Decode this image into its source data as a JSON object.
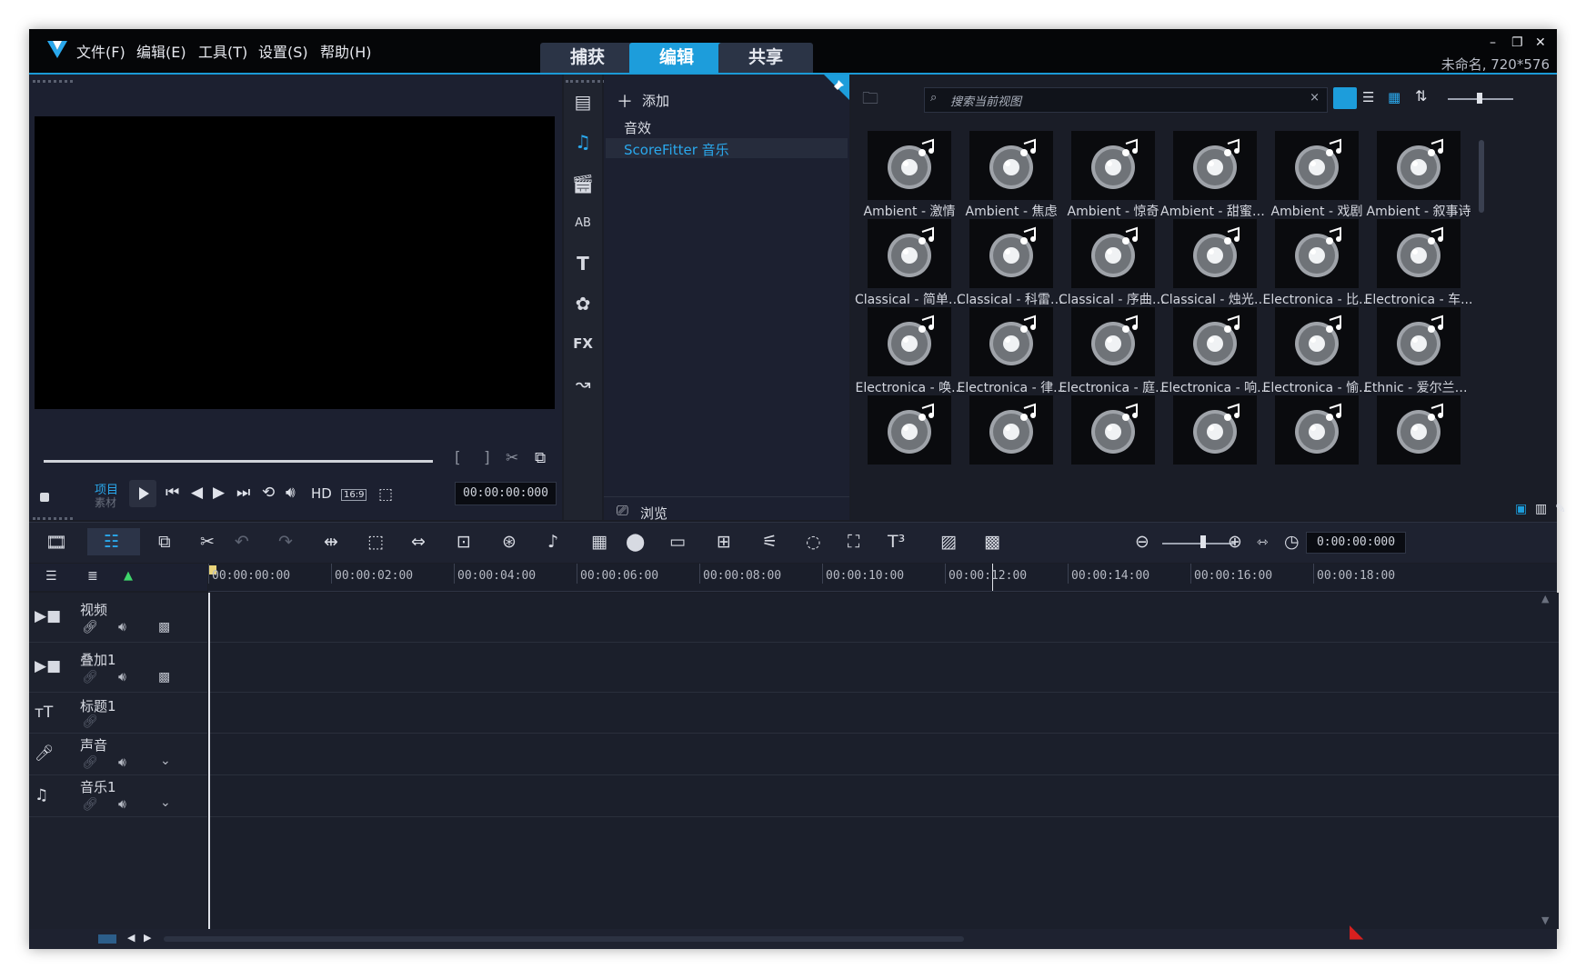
{
  "menu": {
    "file": "文件(F)",
    "edit": "编辑(E)",
    "tools": "工具(T)",
    "settings": "设置(S)",
    "help": "帮助(H)"
  },
  "tabs": {
    "capture": "捕获",
    "edit": "编辑",
    "share": "共享"
  },
  "window": {
    "project_info": "未命名, 720*576",
    "minimize": "–",
    "restore": "❐",
    "close": "✕"
  },
  "preview": {
    "mode_project": "项目",
    "mode_clip": "素材",
    "hd": "HD",
    "ratio": "16:9",
    "timecode": "00:00:00:000"
  },
  "library": {
    "add_label": "添加",
    "tree": [
      "音效",
      "ScoreFitter 音乐"
    ],
    "browse_label": "浏览",
    "search_placeholder": "搜索当前视图",
    "search_clear": "×",
    "items": [
      "Ambient - 激情",
      "Ambient - 焦虑",
      "Ambient - 惊奇",
      "Ambient - 甜蜜回...",
      "Ambient - 戏剧",
      "Ambient - 叙事诗",
      "Classical - 简单礼...",
      "Classical - 科雷利...",
      "Classical - 序曲组...",
      "Classical - 烛光奏...",
      "Electronica - 比...",
      "Electronica - 车...",
      "Electronica - 唤...",
      "Electronica - 律...",
      "Electronica - 庭...",
      "Electronica - 响...",
      "Electronica - 愉...",
      "Ethnic - 爱尔兰高..."
    ]
  },
  "timeline": {
    "timecode": "0:00:00:000",
    "ruler": [
      "00:00:00:00",
      "00:00:02:00",
      "00:00:04:00",
      "00:00:06:00",
      "00:00:08:00",
      "00:00:10:00",
      "00:00:12:00",
      "00:00:14:00",
      "00:00:16:00",
      "00:00:18:00"
    ],
    "tracks": [
      {
        "name": "视频"
      },
      {
        "name": "叠加1"
      },
      {
        "name": "标题1"
      },
      {
        "name": "声音"
      },
      {
        "name": "音乐1"
      }
    ]
  },
  "colors": {
    "accent": "#1d9ddb",
    "tree_selected": "#2aa8ec",
    "background": "#1a1d26"
  }
}
